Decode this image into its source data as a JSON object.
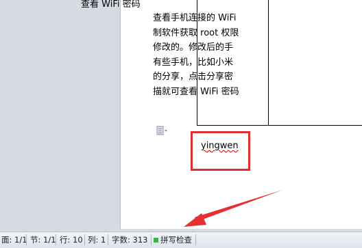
{
  "document": {
    "table_left_text": "查看 WiFi 密码",
    "table_right_lines": [
      "查看手机连接的 WiFi",
      "制软件获取 root 权限",
      "修改的。修改后的手",
      "有些手机，比如小米",
      "的分享，点击分享密",
      "描就可查看 WiFi 密码"
    ],
    "typed_text": "yingwen"
  },
  "statusbar": {
    "page": "面: 1/1",
    "section": "节: 1/1",
    "row": "行: 10",
    "column": "列: 1",
    "word_count": "字数: 313",
    "spell_check": "拼写检查"
  },
  "colors": {
    "highlight_box": "#e02d2d",
    "spell_indicator": "#3fb14a"
  }
}
